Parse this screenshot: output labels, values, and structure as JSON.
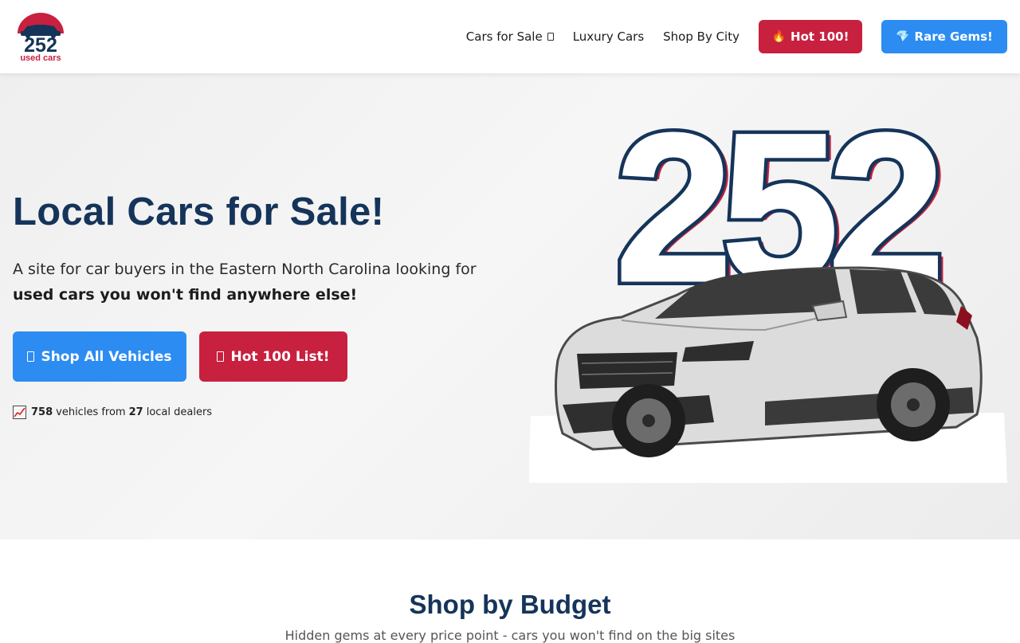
{
  "brand": {
    "logo_number": "252",
    "logo_text": "used cars",
    "primary_color": "#15345a",
    "accent_red": "#c8203f",
    "accent_blue": "#2c8cf1"
  },
  "nav": {
    "items": [
      {
        "label": "Cars for Sale",
        "has_dropdown": true
      },
      {
        "label": "Luxury Cars"
      },
      {
        "label": "Shop By City"
      }
    ],
    "hot_button": {
      "icon": "fire-icon",
      "label": "Hot 100!"
    },
    "gems_button": {
      "icon": "gem-icon",
      "label": "Rare Gems!"
    }
  },
  "hero": {
    "title": "Local Cars for Sale!",
    "description_plain": "A site for car buyers in the Eastern North Carolina looking for",
    "description_bold": "used cars you won't find anywhere else!",
    "shop_button": "Shop All Vehicles",
    "hot_list_button": "Hot 100 List!",
    "stats": {
      "icon": "chart-increasing-icon",
      "vehicle_count": "758",
      "vehicles_text": "vehicles from",
      "dealer_count": "27",
      "dealers_text": "local dealers"
    },
    "art_number": "252"
  },
  "budget": {
    "title": "Shop by Budget",
    "subtitle": "Hidden gems at every price point - cars you won't find on the big sites"
  }
}
